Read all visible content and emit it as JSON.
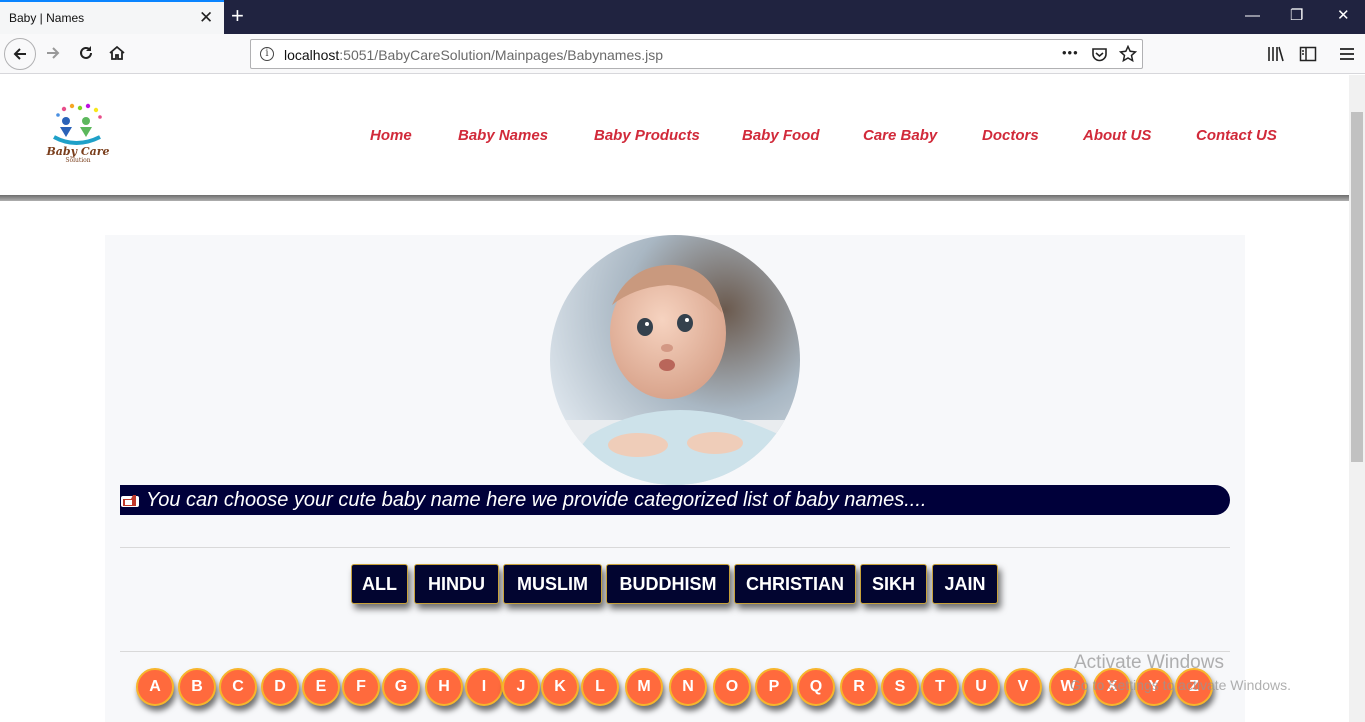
{
  "browser": {
    "tab_title": "Baby | Names",
    "tab_close": "✕",
    "new_tab": "+",
    "url_host": "localhost",
    "url_rest": ":5051/BabyCareSolution/Mainpages/Babynames.jsp",
    "page_actions": "•••",
    "window_controls": {
      "minimize": "—",
      "restore": "❐",
      "close": "✕"
    }
  },
  "site": {
    "logo_text": "Baby Care",
    "logo_sub": "Solution",
    "menu": [
      {
        "label": "Home"
      },
      {
        "label": "Baby Names"
      },
      {
        "label": "Baby Products"
      },
      {
        "label": "Baby Food"
      },
      {
        "label": "Care Baby"
      },
      {
        "label": "Doctors"
      },
      {
        "label": "About US"
      },
      {
        "label": "Contact US"
      }
    ]
  },
  "content": {
    "info_text": "You can choose your cute baby name here we provide categorized list of baby names....",
    "categories": [
      "ALL",
      "HINDU",
      "MUSLIM",
      "BUDDHISM",
      "CHRISTIAN",
      "SIKH",
      "JAIN"
    ],
    "letters": [
      "A",
      "B",
      "C",
      "D",
      "E",
      "F",
      "G",
      "H",
      "I",
      "J",
      "K",
      "L",
      "M",
      "N",
      "O",
      "P",
      "Q",
      "R",
      "S",
      "T",
      "U",
      "V",
      "W",
      "X",
      "Y",
      "Z"
    ]
  },
  "watermark": {
    "line1": "Activate Windows",
    "line2": "Go to Settings to activate Windows."
  },
  "colors": {
    "accent_menu": "#d12a3a",
    "category_bg": "#020530",
    "letter_bg": "#ff6a3d",
    "letter_border": "#f7b52c",
    "info_bar_bg": "#00003a"
  }
}
